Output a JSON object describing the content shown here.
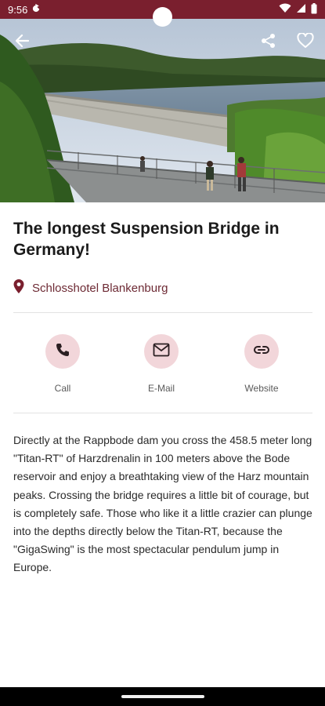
{
  "status_bar": {
    "time": "9:56",
    "icons": [
      "sync-icon",
      "wifi-icon",
      "signal-icon",
      "battery-icon"
    ]
  },
  "hero": {
    "icons": {
      "back": "arrow-back-icon",
      "share": "share-icon",
      "favorite": "heart-outline-icon"
    }
  },
  "detail": {
    "title": "The longest Suspension Bridge in Germany!",
    "location": "Schlosshotel Blankenburg",
    "location_icon": "map-pin-icon",
    "actions": [
      {
        "label": "Call",
        "icon": "phone-icon"
      },
      {
        "label": "E-Mail",
        "icon": "mail-icon"
      },
      {
        "label": "Website",
        "icon": "link-icon"
      }
    ],
    "description": "Directly at the Rappbode dam you cross the 458.5 meter long \"Titan-RT\" of Harzdrenalin in 100 meters above the Bode reservoir and enjoy a breathtaking view of the Harz mountain peaks. Crossing the bridge requires a little bit of courage, but is completely safe. Those who like it a little crazier can plunge into the depths directly below the Titan-RT, because the \"GigaSwing\" is the most spectacular pendulum jump in Europe."
  },
  "colors": {
    "brand": "#7a1f2e",
    "accent_text": "#6d2a34",
    "action_bg": "#f2d6da"
  }
}
